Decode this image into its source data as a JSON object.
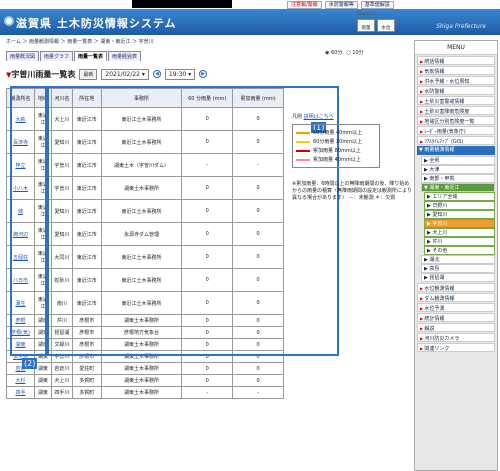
{
  "topbar": {
    "links": [
      "注意報/警報",
      "水防警報等",
      "基準値解説"
    ]
  },
  "header": {
    "title": "滋賀県 土木防災情報システム",
    "en": "Shiga Prefecture"
  },
  "breadcrumb": "ホーム ＞ 雨量観測情報 ＞ 雨量一覧表 ＞ 湖東・東近江 ＞ 宇曽川",
  "tabs": [
    "雨量概況図",
    "雨量グラフ",
    "雨量一覧表",
    "雨量経過表"
  ],
  "shortcut": {
    "label": "Shortcut",
    "buttons": [
      "雨量",
      "水位"
    ]
  },
  "controls": {
    "title": "宇曽川雨量一覧表",
    "latest": "最新",
    "date": "2021/02/22",
    "time": "19:30",
    "radio1": "60分",
    "radio2": "10分"
  },
  "table": {
    "headers": [
      "観測所名",
      "地域",
      "河川名",
      "所在地",
      "事務所",
      "60 分雨量 (mm)",
      "累加雨量 (mm)"
    ],
    "rows": [
      [
        "大萩",
        "東近江",
        "犬上川",
        "東近江市",
        "東近江土木事務所",
        "0",
        "0"
      ],
      [
        "百済寺",
        "東近江",
        "愛知川",
        "東近江市",
        "東近江土木事務所",
        "0",
        "0"
      ],
      [
        "梓立",
        "東近江",
        "宇曽川",
        "東近江市",
        "湖東土木（宇曽川ダム）",
        "-",
        "-"
      ],
      [
        "小八木",
        "東近江",
        "宇曽川",
        "東近江市",
        "湖東土木事務所",
        "0",
        "0"
      ],
      [
        "妹",
        "東近江",
        "愛知川",
        "東近江市",
        "東近江土木事務所",
        "0",
        "0"
      ],
      [
        "御河辺",
        "東近江",
        "愛知川",
        "東近江市",
        "永源寺ダム管理",
        "0",
        "0"
      ],
      [
        "五個荘",
        "東近江",
        "大同川",
        "東近江市",
        "東近江土木事務所",
        "0",
        "0"
      ],
      [
        "八日市",
        "東近江",
        "蛇砂川",
        "東近江市",
        "東近江土木事務所",
        "0",
        "0"
      ],
      [
        "蒲生",
        "東近江",
        "南川",
        "東近江市",
        "東近江土木事務所",
        "0",
        "0"
      ],
      [
        "彦根",
        "湖東",
        "芹川",
        "彦根市",
        "湖東土木事務所",
        "0",
        "0"
      ],
      [
        "彦根(気)",
        "湖東",
        "琵琶湖",
        "彦根市",
        "彦根地方気象台",
        "0",
        "0"
      ],
      [
        "湖東",
        "湖東",
        "文録川",
        "彦根市",
        "湖東土木事務所",
        "0",
        "0"
      ],
      [
        "仏生寺",
        "湖東",
        "宇曽川",
        "彦根市",
        "湖東土木事務所",
        "0",
        "0"
      ],
      [
        "岩倉",
        "湖東",
        "岩倉川",
        "愛荘町",
        "湖東土木事務所",
        "0",
        "0"
      ],
      [
        "大杉",
        "湖東",
        "犬上川",
        "多賀町",
        "湖東土木事務所",
        "0",
        "0"
      ],
      [
        "四手",
        "湖東",
        "四手川",
        "多賀町",
        "湖東土木事務所",
        "-",
        "-"
      ]
    ]
  },
  "annot": {
    "a1": "(1)",
    "a2": "(2)"
  },
  "legend": {
    "link_prefix": "凡例",
    "link": "説明はこちら",
    "items": [
      {
        "label": "60分雨量 40mm以上",
        "color": "#f0a000"
      },
      {
        "label": "60分雨量 20mm以上",
        "color": "#f5d000"
      },
      {
        "label": "累加雨量 80mm以上",
        "color": "#d00000"
      },
      {
        "label": "累加雨量 40mm以上",
        "color": "#ff7fbf"
      }
    ],
    "note": "※累加雨量：6時間以上の無降雨期間の後、降り始めからの雨量の積算（無降雨期間の設定は観測所により異なる場合があります）  －：未観測  ＊：欠測"
  },
  "sidebar": {
    "menu": "MENU",
    "items_top": [
      "統括情報",
      "気象情報",
      "洪水予報・水位周知",
      "水防警報",
      "土砂災害警戒情報",
      "土砂災害降雨危険度",
      "地域区分別危険度一覧",
      "ﾚｰﾀﾞｰ雨量(気象庁)",
      "ﾘｱﾙﾀｲﾑﾏｯﾌﾟ (GIS)"
    ],
    "group": "雨量観測情報",
    "subs": [
      "全県",
      "大津",
      "南部・甲賀"
    ],
    "subgreen": "湖東・東近江",
    "subsubs": [
      "エリア全域",
      "日野川",
      "愛知川",
      "宇曽川",
      "犬上川",
      "芹川",
      "その他"
    ],
    "selected": "宇曽川",
    "subs2": [
      "湖北",
      "高島",
      "琵琶湖"
    ],
    "items_bottom": [
      "水位観測情報",
      "ダム観測情報",
      "水位予測",
      "統計情報",
      "解説",
      "河川防災カメラ",
      "関連リンク"
    ]
  }
}
